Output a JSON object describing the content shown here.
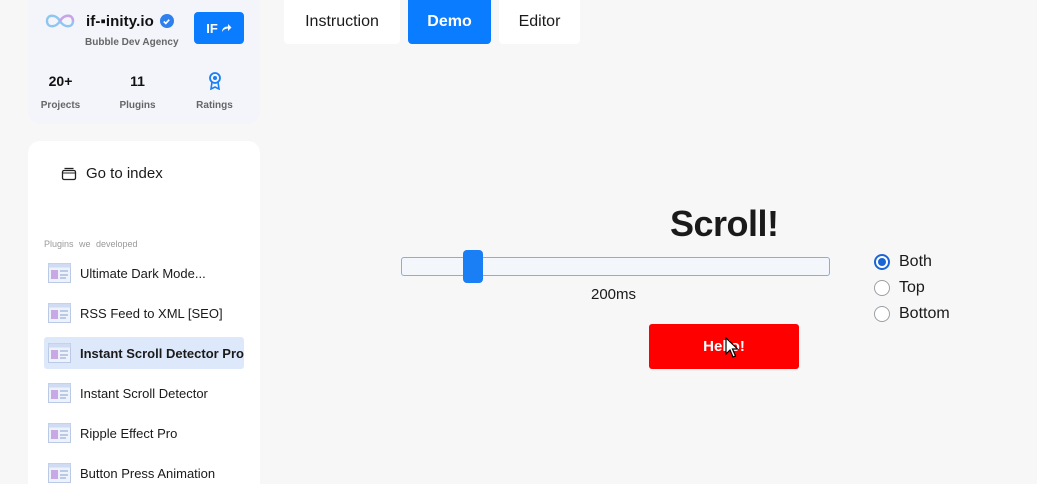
{
  "profile": {
    "brand_name": "if-▪inity.io",
    "brand_sub": "Bubble Dev Agency",
    "if_button": "IF",
    "stats": [
      {
        "value": "20+",
        "label": "Projects"
      },
      {
        "value": "11",
        "label": "Plugins"
      },
      {
        "value": "",
        "label": "Ratings",
        "icon": "medal-icon"
      }
    ]
  },
  "sidebar": {
    "goto_label": "Go to index",
    "section_label": "Plugins we developed",
    "items": [
      {
        "label": "Ultimate Dark Mode...",
        "active": false
      },
      {
        "label": "RSS Feed to XML [SEO]",
        "active": false
      },
      {
        "label": "Instant Scroll Detector Pro",
        "active": true
      },
      {
        "label": "Instant Scroll Detector",
        "active": false
      },
      {
        "label": "Ripple Effect Pro",
        "active": false
      },
      {
        "label": "Button Press Animation",
        "active": false
      }
    ]
  },
  "tabs": [
    {
      "label": "Instruction",
      "active": false
    },
    {
      "label": "Demo",
      "active": true
    },
    {
      "label": "Editor",
      "active": false
    }
  ],
  "demo": {
    "title": "Scroll!",
    "slider_value": "200ms",
    "slider_fraction": 0.1,
    "radio_options": [
      {
        "label": "Both",
        "checked": true
      },
      {
        "label": "Top",
        "checked": false
      },
      {
        "label": "Bottom",
        "checked": false
      }
    ],
    "button_label": "Hello!"
  },
  "colors": {
    "accent": "#0a7cff",
    "button_red": "#ff0000",
    "active_item_bg": "#dde9fb",
    "page_bg": "#f7f7f7"
  }
}
